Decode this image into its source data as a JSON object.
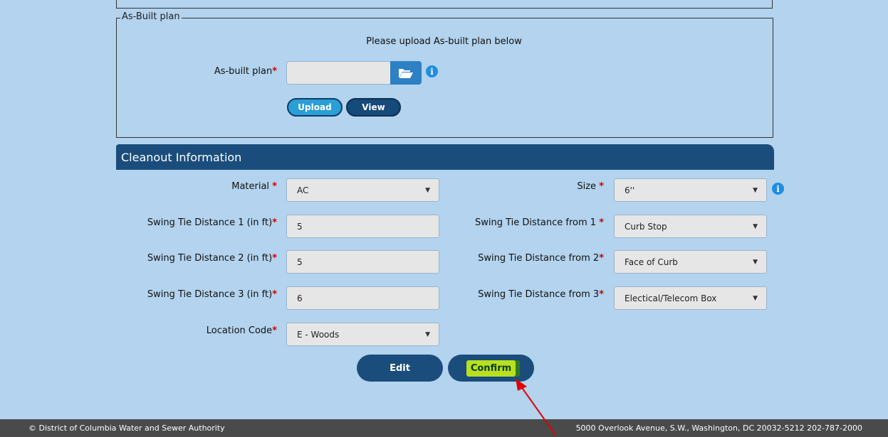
{
  "as_built": {
    "legend": "As-Built plan",
    "note": "Please upload As-built plan below",
    "field_label": "As-built plan",
    "required_mark": "*",
    "file_value": "",
    "upload_label": "Upload",
    "view_label": "View"
  },
  "cleanout": {
    "header": "Cleanout Information",
    "fields": {
      "material": {
        "label": "Material ",
        "value": "AC"
      },
      "size": {
        "label": "Size ",
        "value": "6''"
      },
      "tie_distance_1": {
        "label": "Swing Tie Distance 1 (in ft)",
        "value": "5"
      },
      "tie_from_1": {
        "label": "Swing Tie Distance from 1 ",
        "value": "Curb Stop"
      },
      "tie_distance_2": {
        "label": "Swing Tie Distance 2 (in ft)",
        "value": "5"
      },
      "tie_from_2": {
        "label": "Swing Tie Distance from 2",
        "value": "Face of Curb"
      },
      "tie_distance_3": {
        "label": "Swing Tie Distance 3 (in ft)",
        "value": "6"
      },
      "tie_from_3": {
        "label": "Swing Tie Distance from 3",
        "value": "Electical/Telecom Box"
      },
      "location_code": {
        "label": "Location Code",
        "value": "E - Woods"
      }
    },
    "required_mark": "*",
    "dropdown_arrow": "▼"
  },
  "actions": {
    "edit_label": "Edit",
    "confirm_label": "Confirm"
  },
  "footer": {
    "copyright": "© District of Columbia Water and Sewer Authority",
    "address": "5000 Overlook Avenue, S.W., Washington, DC 20032-5212 202-787-2000"
  },
  "icons": {
    "info": "info-icon",
    "folder": "folder-open-icon",
    "annotation": "red-arrow"
  },
  "colors": {
    "background": "#b3d3ee",
    "header_bar": "#1a4d7b",
    "required": "#d00000",
    "info": "#1f8ee0",
    "confirm_highlight": "#b8e020",
    "annotation_arrow": "#e00000",
    "footer": "#4a4a4a"
  }
}
